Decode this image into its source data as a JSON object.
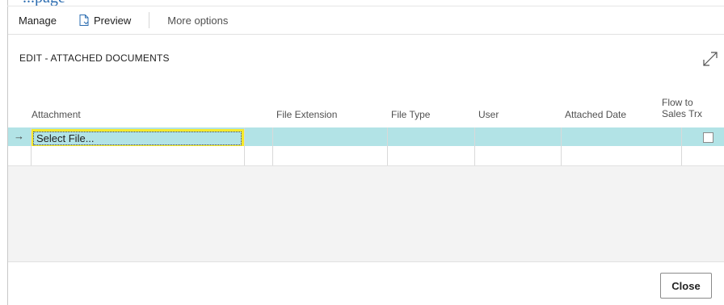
{
  "page": {
    "heading_partial": "...page",
    "title": "EDIT - ATTACHED DOCUMENTS"
  },
  "toolbar": {
    "manage_label": "Manage",
    "preview_label": "Preview",
    "more_options_label": "More options"
  },
  "table": {
    "columns": [
      "Attachment",
      "File Extension",
      "File Type",
      "User",
      "Attached Date",
      "Flow to\nSales Trx"
    ],
    "rows": [
      {
        "attachment": "Select File...",
        "file_extension": "",
        "file_type": "",
        "user": "",
        "attached_date": "",
        "flow_to_sales_trx": false,
        "current": true
      },
      {
        "attachment": "",
        "file_extension": "",
        "file_type": "",
        "user": "",
        "attached_date": "",
        "flow_to_sales_trx": false,
        "current": false
      }
    ]
  },
  "footer": {
    "close_label": "Close"
  },
  "icons": {
    "preview": "document-icon",
    "expand": "expand-icon",
    "current_row": "arrow-right-icon"
  },
  "colors": {
    "selected_row": "#b2e3e6",
    "focus_highlight": "#f5ea2a",
    "accent_blue": "#2b6cb0"
  }
}
